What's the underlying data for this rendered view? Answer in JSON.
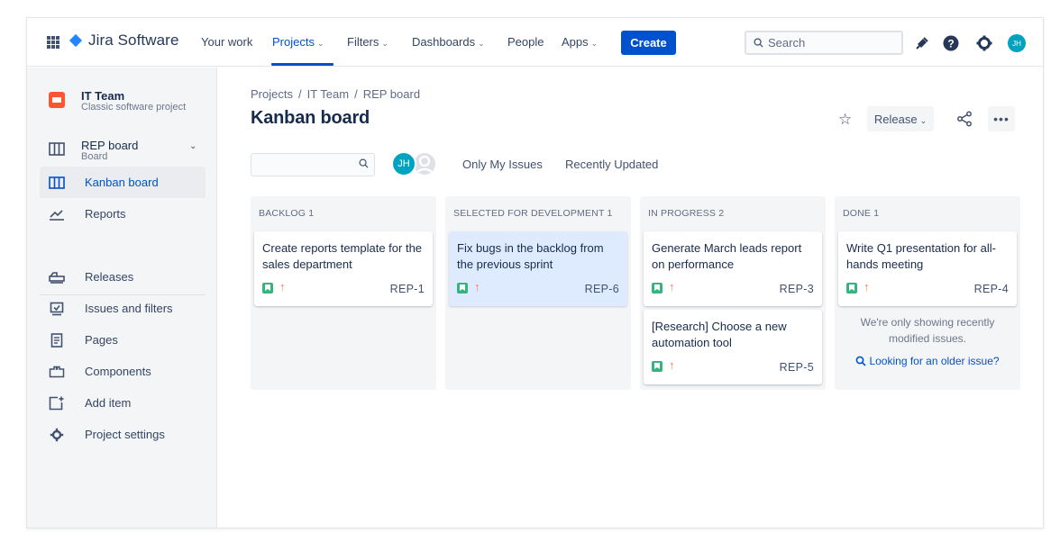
{
  "topnav": {
    "logo_text": "Jira Software",
    "items": [
      {
        "label": "Your work",
        "dropdown": false
      },
      {
        "label": "Projects",
        "dropdown": true
      },
      {
        "label": "Filters",
        "dropdown": true
      },
      {
        "label": "Dashboards",
        "dropdown": true
      },
      {
        "label": "People",
        "dropdown": false
      },
      {
        "label": "Apps",
        "dropdown": true
      }
    ],
    "create_label": "Create",
    "search_placeholder": "Search",
    "avatar_initials": "JH"
  },
  "sidebar": {
    "project_name": "IT Team",
    "project_type": "Classic software project",
    "board_name": "REP board",
    "board_type": "Board",
    "items": [
      {
        "label": "Kanban board",
        "icon": "board-icon",
        "selected": true
      },
      {
        "label": "Reports",
        "icon": "reports-icon",
        "selected": false
      },
      {
        "label": "Releases",
        "icon": "releases-icon",
        "selected": false
      },
      {
        "label": "Issues and filters",
        "icon": "issues-icon",
        "selected": false
      },
      {
        "label": "Pages",
        "icon": "pages-icon",
        "selected": false
      },
      {
        "label": "Components",
        "icon": "components-icon",
        "selected": false
      },
      {
        "label": "Add item",
        "icon": "add-item-icon",
        "selected": false
      },
      {
        "label": "Project settings",
        "icon": "settings-icon",
        "selected": false
      }
    ]
  },
  "main": {
    "breadcrumb": [
      "Projects",
      "IT Team",
      "REP board"
    ],
    "title": "Kanban board",
    "release_label": "Release",
    "more_label": "•••",
    "board_avatar_initials": "JH",
    "filters": [
      "Only My Issues",
      "Recently Updated"
    ]
  },
  "columns": [
    {
      "header": "BACKLOG 1",
      "cards": [
        {
          "summary": "Create reports template for the sales department",
          "key": "REP-1",
          "highlight": false
        }
      ]
    },
    {
      "header": "SELECTED FOR DEVELOPMENT 1",
      "cards": [
        {
          "summary": "Fix bugs in the backlog from the previous sprint",
          "key": "REP-6",
          "highlight": true
        }
      ]
    },
    {
      "header": "IN PROGRESS 2",
      "cards": [
        {
          "summary": "Generate March leads report on performance",
          "key": "REP-3",
          "highlight": false
        },
        {
          "summary": "[Research] Choose a new automation tool",
          "key": "REP-5",
          "highlight": false
        }
      ]
    },
    {
      "header": "DONE 1",
      "cards": [
        {
          "summary": "Write Q1 presentation for all-hands meeting",
          "key": "REP-4",
          "highlight": false
        }
      ],
      "note": "We're only showing recently modified issues.",
      "link": "Looking for an older issue?"
    }
  ],
  "colors": {
    "brand": "#0052cc",
    "story": "#36b37e",
    "priority": "#ff7452",
    "highlight_card": "#deebff"
  }
}
